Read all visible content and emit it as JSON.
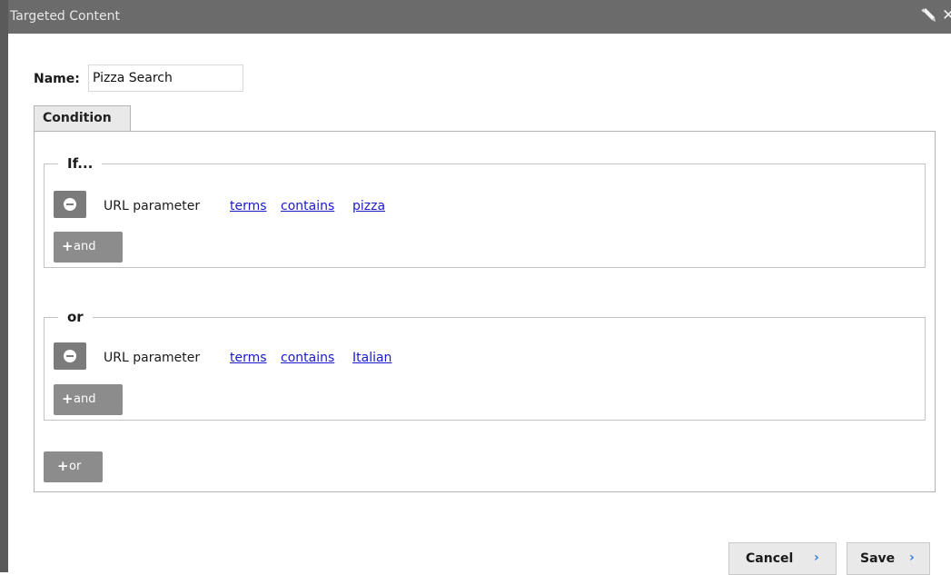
{
  "window": {
    "title": "Targeted Content",
    "close_glyph": "✕",
    "icons": [
      "pencil-icon",
      "close-icon"
    ]
  },
  "form": {
    "name_label": "Name:",
    "name_value": "Pizza Search"
  },
  "tabs": [
    {
      "label": "Condition",
      "selected": true
    }
  ],
  "condition": {
    "groups": [
      {
        "legend": "If...",
        "rules": [
          {
            "prefix": "URL parameter",
            "parameter": "terms",
            "operator": "contains",
            "value": "pizza"
          }
        ],
        "add_and_label": "and"
      },
      {
        "legend": "or",
        "rules": [
          {
            "prefix": "URL parameter",
            "parameter": "terms",
            "operator": "contains",
            "value": "Italian"
          }
        ],
        "add_and_label": "and"
      }
    ],
    "add_or_label": "or",
    "plus_glyph": "+"
  },
  "actions": {
    "cancel_label": "Cancel",
    "save_label": "Save",
    "chevron_glyph": "›"
  },
  "colors": {
    "titlebar": "#6b6b6b",
    "link": "#1a1ac8",
    "gray_button": "#8c8c8c",
    "chevron": "#3a7bd5"
  }
}
